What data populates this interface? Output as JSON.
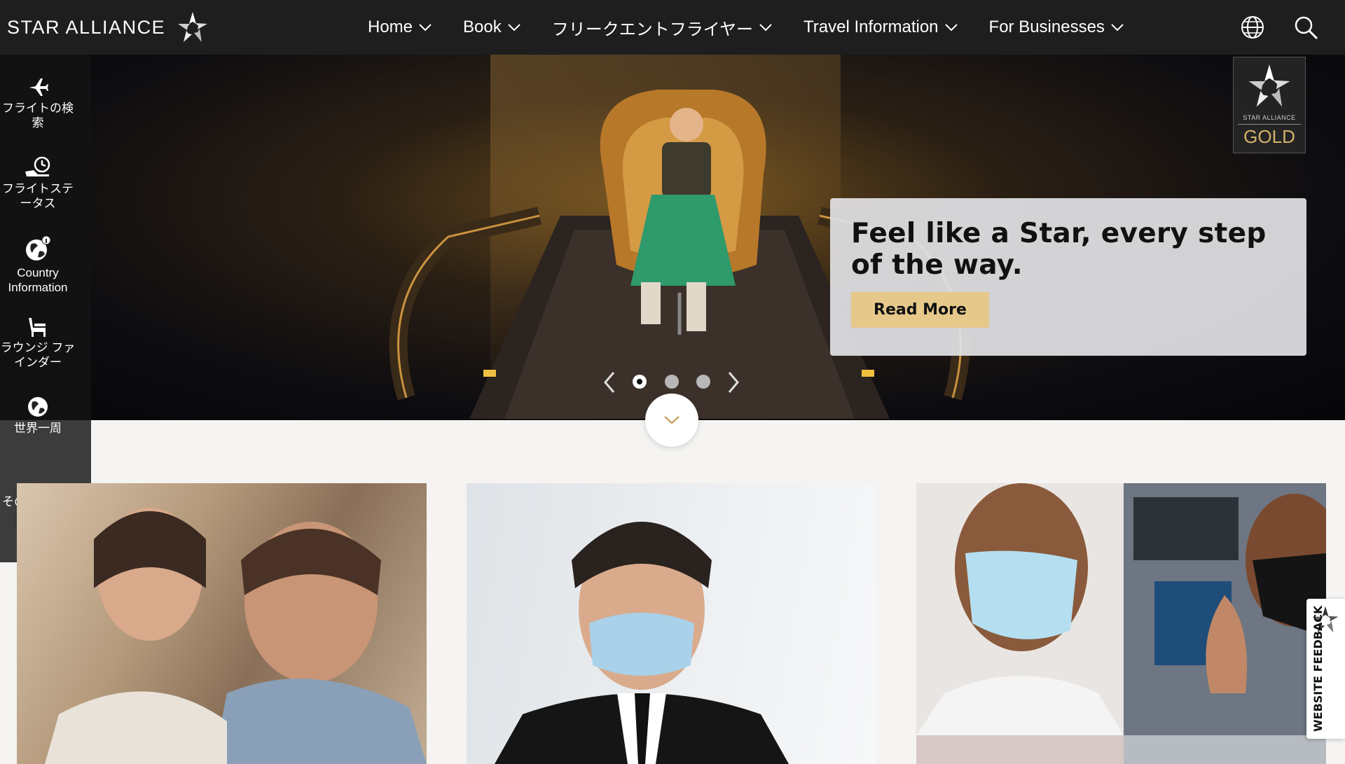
{
  "brand": {
    "name": "STAR ALLIANCE"
  },
  "nav": {
    "items": [
      {
        "label": "Home"
      },
      {
        "label": "Book"
      },
      {
        "label": "フリークエントフライヤー"
      },
      {
        "label": "Travel Information"
      },
      {
        "label": "For Businesses"
      }
    ],
    "icons": [
      "globe-icon",
      "search-icon"
    ]
  },
  "sidebar": {
    "items": [
      {
        "label": "フライトの検索",
        "icon": "airplane-icon"
      },
      {
        "label": "フライトステータス",
        "icon": "flight-status-icon"
      },
      {
        "label": "Country Information",
        "icon": "globe-info-icon"
      },
      {
        "label": "ラウンジ ファインダー",
        "icon": "lounge-chair-icon"
      },
      {
        "label": "世界一周",
        "icon": "world-icon"
      },
      {
        "label": "その他のツール",
        "icon": "more-dots-icon"
      }
    ]
  },
  "hero": {
    "badge_small": "STAR ALLIANCE",
    "badge_tier": "GOLD",
    "title": "Feel like a Star, every step of the way.",
    "cta": "Read More",
    "slide_count": 3,
    "active_slide": 1
  },
  "feedback": {
    "label": "WEBSITE FEEDBACK"
  },
  "colors": {
    "topbar": "#1e1e1e",
    "accent_gold": "#e6c98a",
    "badge_gold": "#d4b26a"
  }
}
